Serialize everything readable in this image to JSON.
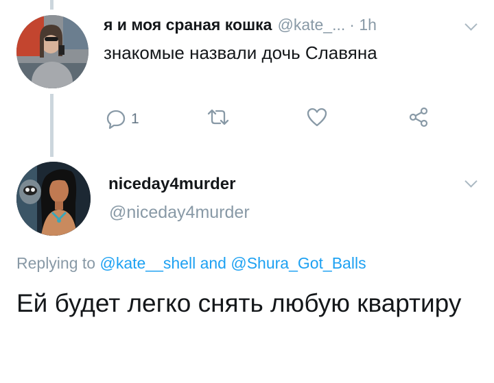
{
  "tweet1": {
    "name": "я и моя сраная кошка",
    "handle": "@kate_...",
    "time": "· 1h",
    "text": "знакомые назвали дочь Славяна",
    "reply_count": "1"
  },
  "tweet2": {
    "name": "niceday4murder",
    "handle": "@niceday4murder",
    "replying_prefix": "Replying to",
    "mention1": "@kate__shell",
    "and": "and",
    "mention2": "@Shura_Got_Balls",
    "text": "Ей будет легко снять любую квартиру"
  },
  "icons": {
    "reply": "reply-icon",
    "retweet": "retweet-icon",
    "like": "heart-icon",
    "share": "share-icon",
    "menu": "chevron-down-icon"
  },
  "colors": {
    "link": "#1da1f2",
    "muted": "#8899a6",
    "text": "#14171a",
    "thread_line": "#ccd6dd"
  }
}
